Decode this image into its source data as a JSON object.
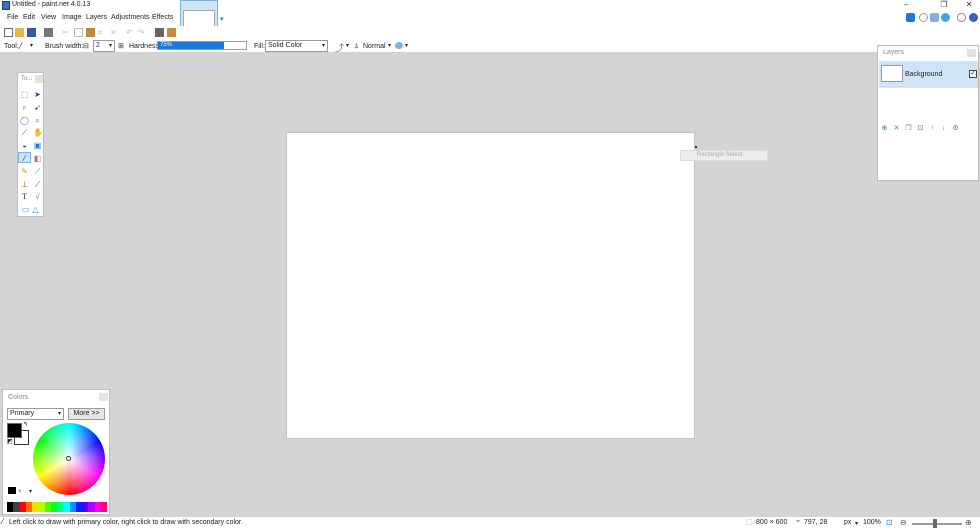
{
  "window": {
    "title": "Untitled - paint.net 4.0.13"
  },
  "menu": [
    "File",
    "Edit",
    "View",
    "Image",
    "Layers",
    "Adjustments",
    "Effects"
  ],
  "toolbar": {
    "tool_label": "Tool:",
    "brush_width_label": "Brush width:",
    "brush_width_value": "2",
    "hardness_label": "Hardness:",
    "hardness_value": "75%",
    "hardness_fraction": 0.75,
    "fill_label": "Fill:",
    "fill_value": "Solid Color",
    "blend_mode": "Normal"
  },
  "tools_panel": {
    "title": "To..."
  },
  "tooltip": "Rectangle Select",
  "layers_panel": {
    "title": "Layers",
    "layers": [
      {
        "name": "Background",
        "visible": true
      }
    ]
  },
  "colors_panel": {
    "title": "Colors",
    "mode": "Primary",
    "more_label": "More >>",
    "primary_color": "#000000",
    "secondary_color": "#ffffff",
    "palette": [
      "#000000",
      "#404040",
      "#ff0000",
      "#ff6a00",
      "#ffd800",
      "#b6ff00",
      "#4cff00",
      "#00ff21",
      "#00ff90",
      "#00ffff",
      "#0094ff",
      "#0026ff",
      "#4800ff",
      "#b200ff",
      "#ff00dc",
      "#ff006e"
    ]
  },
  "status": {
    "hint": "Left click to draw with primary color, right click to draw with secondary color.",
    "image_size": "800 × 600",
    "cursor_pos": "797, 28",
    "units": "px",
    "zoom": "100%"
  },
  "colors": {
    "accent": "#1a7bd6",
    "selection": "#cfe4f7"
  }
}
